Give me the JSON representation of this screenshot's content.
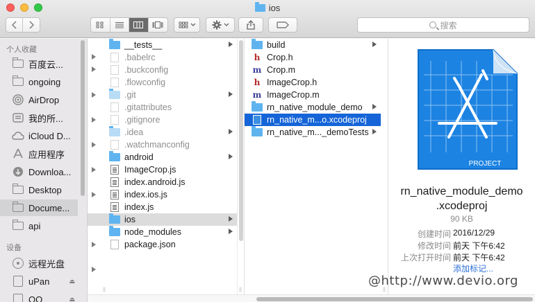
{
  "window": {
    "title": "ios"
  },
  "search": {
    "placeholder": "搜索"
  },
  "sidebar": {
    "favorites_header": "个人收藏",
    "devices_header": "设备",
    "favorites": [
      {
        "label": "百度云...",
        "icon": "folder-icon"
      },
      {
        "label": "ongoing",
        "icon": "folder-icon"
      },
      {
        "label": "AirDrop",
        "icon": "airdrop-icon"
      },
      {
        "label": "我的所...",
        "icon": "all-files-icon"
      },
      {
        "label": "iCloud D...",
        "icon": "cloud-icon"
      },
      {
        "label": "应用程序",
        "icon": "applications-icon"
      },
      {
        "label": "Downloa...",
        "icon": "downloads-icon"
      },
      {
        "label": "Desktop",
        "icon": "desktop-folder-icon"
      },
      {
        "label": "Docume...",
        "icon": "documents-folder-icon",
        "selected": true
      },
      {
        "label": "api",
        "icon": "folder-icon"
      }
    ],
    "devices": [
      {
        "label": "远程光盘",
        "icon": "disc-icon"
      },
      {
        "label": "uPan",
        "icon": "disk-icon",
        "eject": true
      },
      {
        "label": "QQ",
        "icon": "disk-icon",
        "eject": true
      }
    ]
  },
  "column1": {
    "items": [
      {
        "name": "__tests__",
        "type": "folder",
        "arrow": true
      },
      {
        "name": ".babelrc",
        "type": "doc",
        "dim": true
      },
      {
        "name": ".buckconfig",
        "type": "doc",
        "dim": true
      },
      {
        "name": ".flowconfig",
        "type": "doc",
        "dim": true
      },
      {
        "name": ".git",
        "type": "folder-faint",
        "dim": true,
        "arrow": true
      },
      {
        "name": ".gitattributes",
        "type": "doc",
        "dim": true
      },
      {
        "name": ".gitignore",
        "type": "doc",
        "dim": true
      },
      {
        "name": ".idea",
        "type": "folder-faint",
        "dim": true,
        "arrow": true
      },
      {
        "name": ".watchmanconfig",
        "type": "doc",
        "dim": true
      },
      {
        "name": "android",
        "type": "folder",
        "arrow": true
      },
      {
        "name": "ImageCrop.js",
        "type": "js"
      },
      {
        "name": "index.android.js",
        "type": "js"
      },
      {
        "name": "index.ios.js",
        "type": "js"
      },
      {
        "name": "index.js",
        "type": "js"
      },
      {
        "name": "ios",
        "type": "folder",
        "arrow": true,
        "selected": true
      },
      {
        "name": "node_modules",
        "type": "folder",
        "arrow": true
      },
      {
        "name": "package.json",
        "type": "doc"
      }
    ]
  },
  "column2": {
    "items": [
      {
        "name": "build",
        "type": "folder",
        "arrow": true
      },
      {
        "name": "Crop.h",
        "type": "h"
      },
      {
        "name": "Crop.m",
        "type": "m"
      },
      {
        "name": "ImageCrop.h",
        "type": "h"
      },
      {
        "name": "ImageCrop.m",
        "type": "m"
      },
      {
        "name": "rn_native_module_demo",
        "type": "folder",
        "arrow": true
      },
      {
        "name": "rn_native_m...o.xcodeproj",
        "type": "xcodeproj",
        "selected": true
      },
      {
        "name": "rn_native_m..._demoTests",
        "type": "folder",
        "arrow": true
      }
    ]
  },
  "preview": {
    "icon_badge": "PROJECT",
    "name_line1": "rn_native_module_demo",
    "name_line2": ".xcodeproj",
    "size": "90 KB",
    "meta": [
      {
        "key": "创建时间",
        "value": "2016/12/29"
      },
      {
        "key": "修改时间",
        "value": "前天 下午6:42"
      },
      {
        "key": "上次打开时间",
        "value": "前天 下午6:42"
      }
    ],
    "add_tags": "添加标记..."
  },
  "watermark": "@http://www.devio.org",
  "colors": {
    "selection_blue": "#1565d8",
    "folder_blue": "#5fb4ef",
    "link": "#2c6ed6"
  }
}
